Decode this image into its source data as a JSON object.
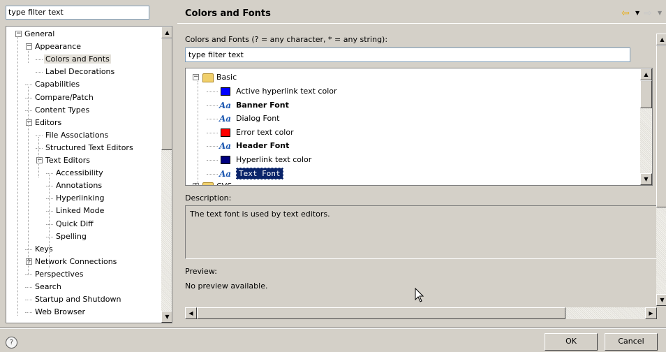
{
  "left": {
    "filter_value": "type filter text",
    "tree": [
      {
        "label": "General",
        "expander": "−"
      },
      {
        "label": "Appearance",
        "expander": "−"
      },
      {
        "label": "Colors and Fonts"
      },
      {
        "label": "Label Decorations"
      },
      {
        "label": "Capabilities"
      },
      {
        "label": "Compare/Patch"
      },
      {
        "label": "Content Types"
      },
      {
        "label": "Editors",
        "expander": "−"
      },
      {
        "label": "File Associations"
      },
      {
        "label": "Structured Text Editors"
      },
      {
        "label": "Text Editors",
        "expander": "−"
      },
      {
        "label": "Accessibility"
      },
      {
        "label": "Annotations"
      },
      {
        "label": "Hyperlinking"
      },
      {
        "label": "Linked Mode"
      },
      {
        "label": "Quick Diff"
      },
      {
        "label": "Spelling"
      },
      {
        "label": "Keys"
      },
      {
        "label": "Network Connections",
        "expander": "+"
      },
      {
        "label": "Perspectives"
      },
      {
        "label": "Search"
      },
      {
        "label": "Startup and Shutdown"
      },
      {
        "label": "Web Browser"
      }
    ]
  },
  "right": {
    "title": "Colors and Fonts",
    "filter_label": "Colors and Fonts (? = any character, * = any string):",
    "filter_value": "type filter text",
    "category": {
      "label": "Basic",
      "expander": "−"
    },
    "items": [
      {
        "label": "Active hyperlink text color",
        "kind": "color",
        "color": "#0000ff"
      },
      {
        "label": "Banner Font",
        "kind": "font",
        "bold": true
      },
      {
        "label": "Dialog Font",
        "kind": "font"
      },
      {
        "label": "Error text color",
        "kind": "color",
        "color": "#ff0000"
      },
      {
        "label": "Header Font",
        "kind": "font",
        "bold": true
      },
      {
        "label": "Hyperlink text color",
        "kind": "color",
        "color": "#000080"
      },
      {
        "label": "Text Font",
        "kind": "font",
        "selected": true
      }
    ],
    "font_glyph": "Aa",
    "next_category_partial": "CVS",
    "description_label": "Description:",
    "description_text": "The text font is used by text editors.",
    "preview_label": "Preview:",
    "preview_text": "No preview available."
  },
  "buttons": {
    "help": "?",
    "ok": "OK",
    "cancel": "Cancel"
  },
  "icons": {
    "back": "back-arrow-icon",
    "forward": "forward-arrow-icon"
  }
}
